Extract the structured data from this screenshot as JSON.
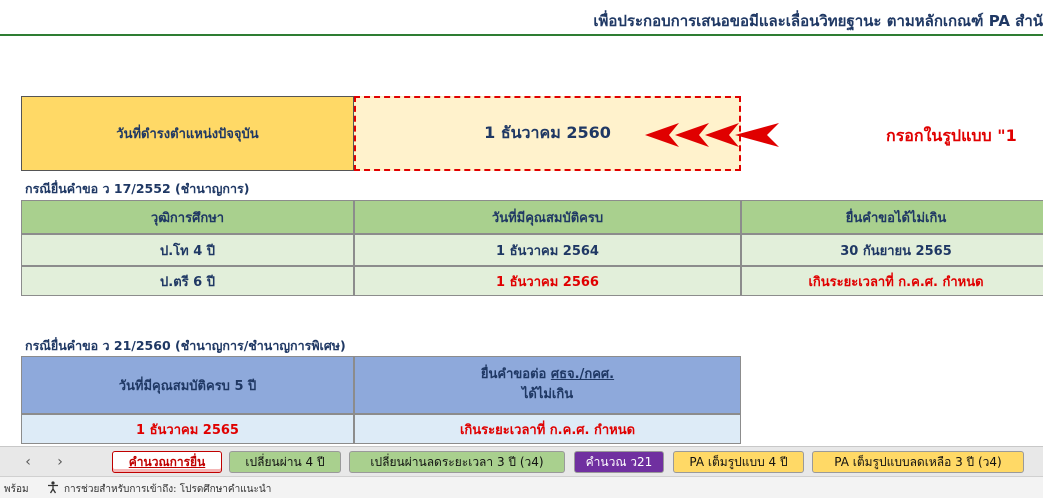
{
  "header": {
    "title": "เพื่อประกอบการเสนอขอมีและเลื่อนวิทยฐานะ ตามหลักเกณฑ์ PA สำนั"
  },
  "current_position": {
    "label": "วันที่ดำรงตำแหน่งปัจจุบัน",
    "value": "1 ธันวาคม 2560",
    "arrows": "<<<<",
    "instruction": "กรอกในรูปแบบ \"1"
  },
  "case1": {
    "heading": "กรณียื่นคำขอ ว 17/2552 (ชำนาญการ)",
    "columns": [
      "วุฒิการศึกษา",
      "วันที่มีคุณสมบัติครบ",
      "ยื่นคำขอได้ไม่เกิน"
    ],
    "rows": [
      {
        "degree": "ป.โท  4 ปี",
        "qualified": "1 ธันวาคม 2564",
        "deadline": "30 กันยายน 2565"
      },
      {
        "degree": "ป.ตรี  6 ปี",
        "qualified": "1 ธันวาคม 2566",
        "deadline": "เกินระยะเวลาที่ ก.ค.ศ. กำหนด"
      }
    ]
  },
  "case2": {
    "heading": "กรณียื่นคำขอ ว 21/2560 (ชำนาญการ/ชำนาญการพิเศษ)",
    "col1": "วันที่มีคุณสมบัติครบ 5 ปี",
    "col2_line1_prefix": "ยื่นคำขอต่อ ",
    "col2_line1_link": "ศธจ./กคศ.",
    "col2_line2": "ได้ไม่เกิน",
    "row": {
      "qualified": "1 ธันวาคม 2565",
      "deadline": "เกินระยะเวลาที่ ก.ค.ศ. กำหนด"
    }
  },
  "sheet_tabs": [
    {
      "label": "คำนวณการยื่น",
      "active": true
    },
    {
      "label": "เปลี่ยนผ่าน 4 ปี"
    },
    {
      "label": "เปลี่ยนผ่านลดระยะเวลา 3 ปี (ว4)"
    },
    {
      "label": "คำนวณ ว21"
    },
    {
      "label": "PA เต็มรูปแบบ 4 ปี"
    },
    {
      "label": "PA เต็มรูปแบบลดเหลือ 3 ปี (ว4)"
    }
  ],
  "nav": {
    "prev": "‹",
    "next": "›"
  },
  "status": {
    "ready": "พร้อม",
    "accessibility": "การช่วยสำหรับการเข้าถึง: โปรดศึกษาคำแนะนำ"
  },
  "colors": {
    "yellow": "#ffd966",
    "cream": "#fff2cc",
    "green_header": "#a9d08e",
    "green_row": "#e2efda",
    "blue_header": "#8ea9db",
    "blue_row": "#ddebf7",
    "red": "#e00000",
    "navy": "#1f3864"
  }
}
